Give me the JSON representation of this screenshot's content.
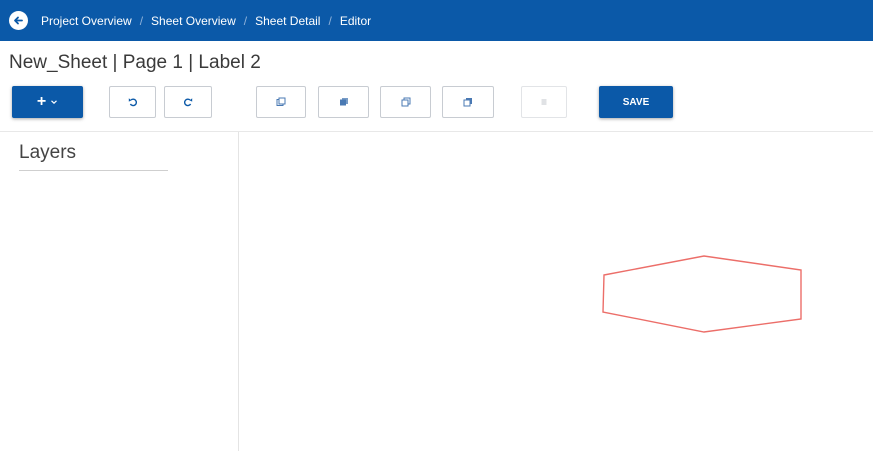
{
  "header": {
    "back_icon": "arrow-left-circle-icon",
    "breadcrumbs": [
      {
        "label": "Project Overview"
      },
      {
        "label": "Sheet Overview"
      },
      {
        "label": "Sheet Detail"
      },
      {
        "label": "Editor"
      }
    ],
    "separator": "/"
  },
  "page": {
    "title": "New_Sheet | Page 1 | Label 2"
  },
  "toolbar": {
    "add_label": "+",
    "add_dropdown_icon": "caret-down-icon",
    "undo_icon": "undo-icon",
    "redo_icon": "redo-icon",
    "copy_icon": "copy-icon",
    "fill_icon": "layer-filled-icon",
    "duplicate_icon": "duplicate-icon",
    "frame_icon": "frame-icon",
    "menu_icon": "menu-lines-icon",
    "save_label": "SAVE"
  },
  "sidebar": {
    "title": "Layers"
  },
  "canvas": {
    "shape": "hexagon",
    "stroke_color": "#ec6e69"
  },
  "colors": {
    "primary": "#0b59a8",
    "shape_stroke": "#ec6e69"
  }
}
